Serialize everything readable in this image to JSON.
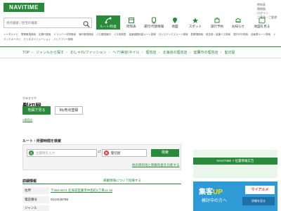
{
  "header": {
    "logo": "NAVITIME",
    "search_placeholder": "地点検索 / 住宅の検索",
    "sublinks": [
      "時刻表",
      "路線図",
      "ログイン",
      "ご意見・ご要望"
    ]
  },
  "gnav": [
    {
      "label": "ルート/料金",
      "icon": "route-icon",
      "active": true
    },
    {
      "label": "時刻表",
      "icon": "timetable-icon",
      "active": false
    },
    {
      "label": "運行/代替情報",
      "icon": "train-info-icon",
      "active": false
    },
    {
      "label": "地図",
      "icon": "map-icon",
      "active": false
    },
    {
      "label": "スポット",
      "icon": "spot-icon",
      "active": false
    },
    {
      "label": "旅行予約",
      "icon": "travel-icon",
      "active": false
    },
    {
      "label": "お知らせ",
      "icon": "notice-icon",
      "active": false
    },
    {
      "label": "地図を見る",
      "icon": "view-map-icon",
      "active": false
    }
  ],
  "categories": [
    "トータルナビ",
    "電車乗換検索",
    "定期代検索",
    "ドライバー渋滞検索",
    "海外乗換検索",
    "バス乗換案内",
    "バス時刻表",
    "高速道路料金ルート検索",
    "ロジスティクスルート検索",
    "駐車場検索",
    "航空券・高速バス検索",
    "運行代行検索",
    "自転車ルート検索",
    "トラックカーナビ",
    "ビジネスソリューション",
    "バリアフリー検索"
  ],
  "breadcrumbs": [
    "TOP",
    "ジャンルから探す",
    "おしゃれ/ファッション",
    "ヘア/美容/ネイル",
    "理容店",
    "北海道の理容店",
    "室蘭市の理容店",
    "髪切屋"
  ],
  "place": {
    "kana": "かみきりや",
    "name": "髪切屋",
    "map_button": "地図で見る",
    "mypage_button": "My地点登録",
    "phone_link": "0理容店"
  },
  "route": {
    "heading": "ルート・所要時間を検索",
    "from_placeholder": "出発地を入力",
    "to_value": "髪切屋",
    "search_button": "検索",
    "more_link": "他の目的地と移動料金を比較する"
  },
  "detail": {
    "heading": "詳細情報",
    "note": "掲載情報について指摘する",
    "rows": [
      {
        "label": "住所",
        "value": "〒050-0074 北海道室蘭市中島町2丁目11-18"
      },
      {
        "label": "電話番号",
        "value": "0143449768"
      },
      {
        "label": "ジャンル",
        "value": ""
      }
    ]
  },
  "ads": {
    "navitime_label": "NAVITIME × 位置情報広告",
    "banner_line1": "集客",
    "banner_up": "UP",
    "banner_line2": "検討中の方へ",
    "banner_brand": "マイアルメ",
    "banner_cta": "詳細を見る"
  }
}
